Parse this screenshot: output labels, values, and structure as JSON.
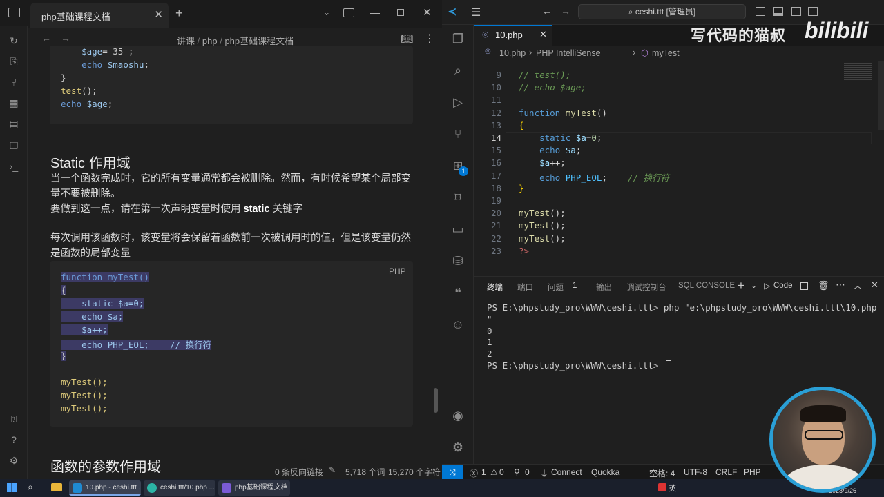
{
  "left_app": {
    "tab_title": "php基础课程文档",
    "breadcrumb": [
      "讲课",
      "php",
      "php基础课程文档"
    ],
    "code_top": [
      {
        "indent": "    ",
        "parts": [
          [
            "var",
            "$age"
          ],
          [
            "op",
            "= 35 ;"
          ]
        ]
      },
      {
        "indent": "    ",
        "parts": [
          [
            "kw",
            "echo "
          ],
          [
            "var",
            "$maoshu"
          ],
          [
            "op",
            ";"
          ]
        ]
      },
      {
        "indent": "",
        "parts": [
          [
            "op",
            "}"
          ]
        ]
      },
      {
        "indent": "",
        "parts": [
          [
            "fn",
            "test"
          ],
          [
            "op",
            "();"
          ]
        ]
      },
      {
        "indent": "",
        "parts": [
          [
            "kw",
            "echo "
          ],
          [
            "var",
            "$age"
          ],
          [
            "op",
            ";"
          ]
        ]
      }
    ],
    "heading": "Static 作用域",
    "para1_line1": "当一个函数完成时，它的所有变量通常都会被删除。然而，有时候希望某个局部变",
    "para1_line2": "量不要被删除。",
    "para2_prefix": "要做到这一点，请在第一次声明变量时使用 ",
    "para2_bold": "static",
    "para2_suffix": " 关键字",
    "para3_line1": "每次调用该函数时，该变量将会保留着函数前一次被调用时的值，但是该变量仍然",
    "para3_line2": "是函数的局部变量",
    "code_lang": "PHP",
    "code_main": [
      "function myTest()",
      "{",
      "    static $a=0;",
      "    echo $a;",
      "    $a++;",
      "    echo PHP_EOL;    // 换行符",
      "}",
      "",
      "myTest();",
      "myTest();",
      "myTest();"
    ],
    "heading2": "函数的参数作用域",
    "status": {
      "backlinks": "0 条反向链接",
      "words": "5,718 个词",
      "chars": "15,270 个字符"
    }
  },
  "vscode": {
    "search": "ceshi.ttt [管理员]",
    "tab": "10.php",
    "breadcrumb": [
      "10.php",
      "PHP IntelliSense",
      "myTest"
    ],
    "lines": [
      {
        "n": "9",
        "code": [
          [
            "cmt",
            "// test();"
          ]
        ]
      },
      {
        "n": "10",
        "code": [
          [
            "cmt",
            "// echo $age;"
          ]
        ]
      },
      {
        "n": "11",
        "code": []
      },
      {
        "n": "12",
        "code": [
          [
            "kw",
            "function "
          ],
          [
            "fn",
            "myTest"
          ],
          [
            "op",
            "()"
          ]
        ]
      },
      {
        "n": "13",
        "code": [
          [
            "br",
            "{"
          ]
        ]
      },
      {
        "n": "14",
        "code": [
          [
            "op",
            "    "
          ],
          [
            "kw",
            "static "
          ],
          [
            "var",
            "$a"
          ],
          [
            "op",
            "="
          ],
          [
            "num",
            "0"
          ],
          [
            "op",
            ";"
          ]
        ]
      },
      {
        "n": "15",
        "code": [
          [
            "op",
            "    "
          ],
          [
            "kw",
            "echo "
          ],
          [
            "var",
            "$a"
          ],
          [
            "op",
            ";"
          ]
        ]
      },
      {
        "n": "16",
        "code": [
          [
            "op",
            "    "
          ],
          [
            "var",
            "$a"
          ],
          [
            "op",
            "++;"
          ]
        ]
      },
      {
        "n": "17",
        "code": [
          [
            "op",
            "    "
          ],
          [
            "kw",
            "echo "
          ],
          [
            "cst",
            "PHP_EOL"
          ],
          [
            "op",
            ";    "
          ],
          [
            "cmt",
            "// 换行符"
          ]
        ]
      },
      {
        "n": "18",
        "code": [
          [
            "br",
            "}"
          ]
        ]
      },
      {
        "n": "19",
        "code": []
      },
      {
        "n": "20",
        "code": [
          [
            "fn",
            "myTest"
          ],
          [
            "op",
            "();"
          ]
        ]
      },
      {
        "n": "21",
        "code": [
          [
            "fn",
            "myTest"
          ],
          [
            "op",
            "();"
          ]
        ]
      },
      {
        "n": "22",
        "code": [
          [
            "fn",
            "myTest"
          ],
          [
            "op",
            "();"
          ]
        ]
      },
      {
        "n": "23",
        "code": [
          [
            "tagc",
            "?>"
          ]
        ]
      }
    ],
    "panel_tabs": [
      "终端",
      "端口",
      "问题",
      "输出",
      "调试控制台",
      "SQL CONSOLE"
    ],
    "problems_count": "1",
    "code_label": "Code",
    "terminal": [
      "PS E:\\phpstudy_pro\\WWW\\ceshi.ttt> php \"e:\\phpstudy_pro\\WWW\\ceshi.ttt\\10.php",
      "\"",
      "0",
      "1",
      "2",
      "PS E:\\phpstudy_pro\\WWW\\ceshi.ttt> "
    ],
    "status": {
      "errors": "1",
      "warnings": "0",
      "ports": "0",
      "connect": "Connect",
      "quokka": "Quokka",
      "spaces": "空格: 4",
      "encoding": "UTF-8",
      "eol": "CRLF",
      "lang": "PHP"
    }
  },
  "taskbar": {
    "items": [
      "10.php - ceshi.ttt ...",
      "ceshi.ttt/10.php ...",
      "php基础课程文档 ..."
    ],
    "ime": "英",
    "date": "2023/9/26"
  },
  "watermark": "写代码的猫叔",
  "bili_logo": "bilibili"
}
